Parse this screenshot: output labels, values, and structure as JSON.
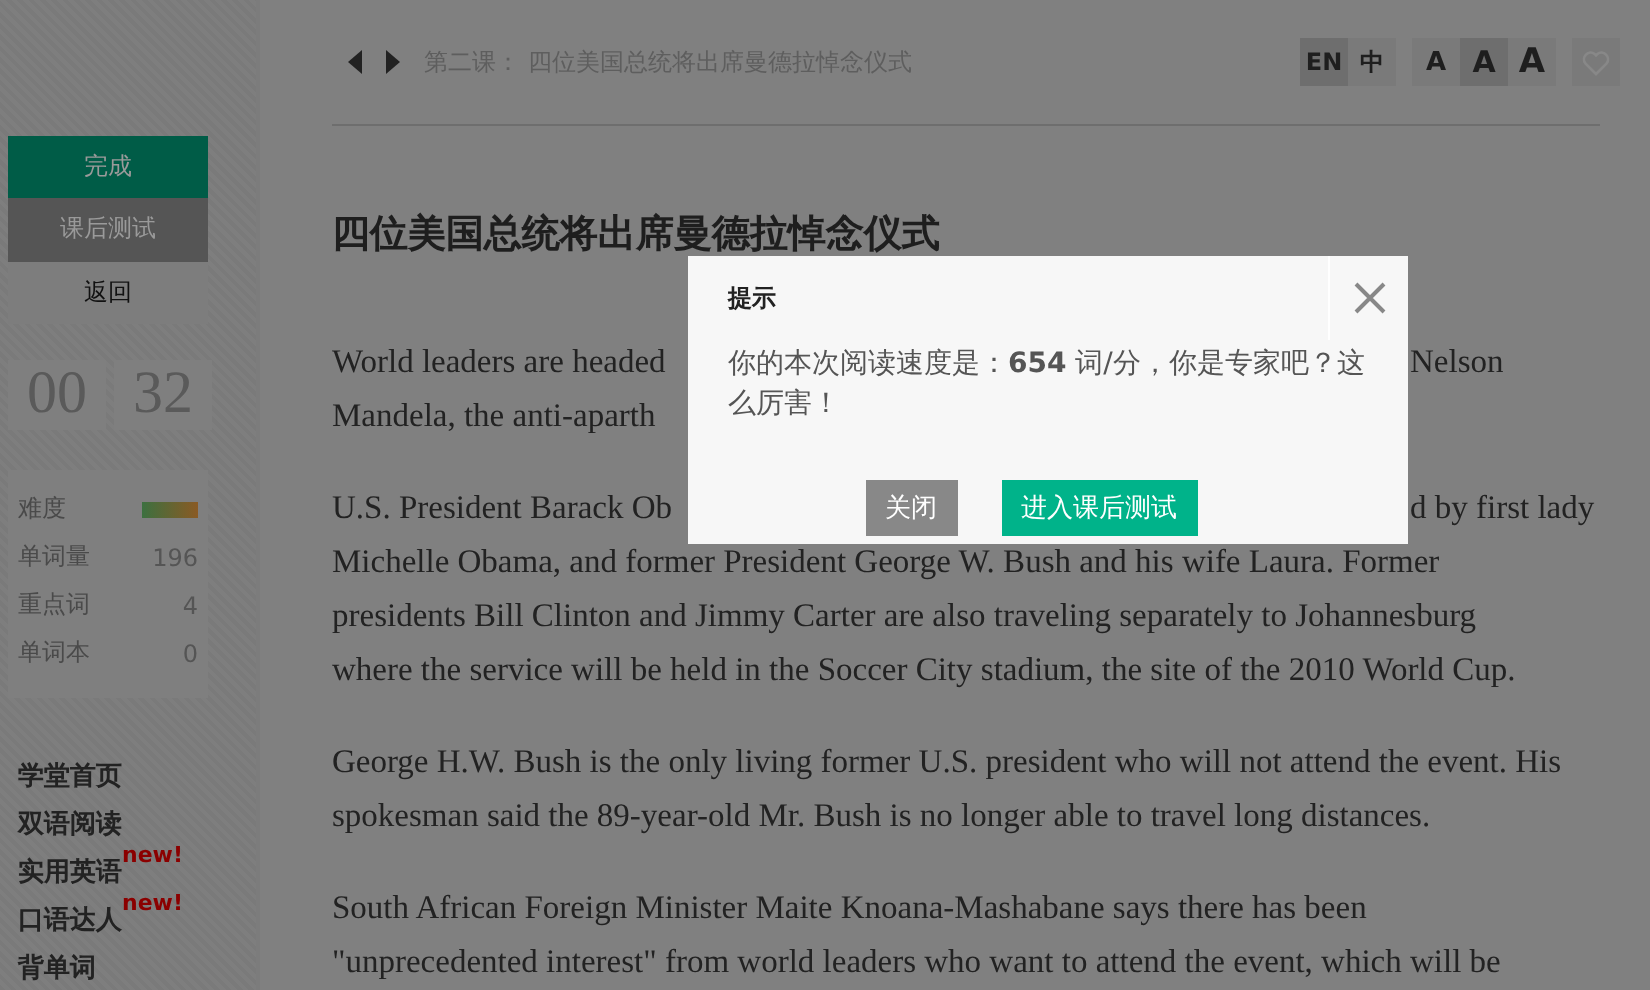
{
  "sidebar": {
    "actions": [
      {
        "label": "完成",
        "kind": "primary"
      },
      {
        "label": "课后测试",
        "kind": "secondary"
      },
      {
        "label": "返回",
        "kind": "plain"
      }
    ],
    "timer": [
      "00",
      "32"
    ],
    "stats": [
      {
        "label": "难度",
        "kind": "bar"
      },
      {
        "label": "单词量",
        "value": "196",
        "kind": "number"
      },
      {
        "label": "重点词",
        "value": "4",
        "kind": "number"
      },
      {
        "label": "单词本",
        "value": "0",
        "kind": "number"
      }
    ],
    "nav": [
      {
        "label": "学堂首页"
      },
      {
        "label": "双语阅读"
      },
      {
        "label": "实用英语",
        "badge": "new!"
      },
      {
        "label": "口语达人",
        "badge": "new!"
      },
      {
        "label": "背单词"
      }
    ]
  },
  "toolbar": {
    "lesson": "第二课：",
    "title": "四位美国总统将出席曼德拉悼念仪式",
    "languages": [
      {
        "label": "EN",
        "selected": true
      },
      {
        "label": "中",
        "selected": false
      }
    ],
    "font_sizes": [
      {
        "label": "A",
        "selected": false
      },
      {
        "label": "A",
        "selected": true
      },
      {
        "label": "A",
        "selected": false
      }
    ],
    "favorite": {
      "liked": false
    }
  },
  "article": {
    "title": "四位美国总统将出席曼德拉悼念仪式",
    "paragraphs": [
      [
        [
          "World leaders are headed",
          "Nelson"
        ],
        [
          "Mandela, the anti-aparth"
        ]
      ],
      [
        [
          "U.S. President Barack Ob",
          "d by first lady"
        ],
        [
          "Michelle Obama, and former President George W. Bush and his wife Laura. Former"
        ],
        [
          "presidents Bill Clinton and Jimmy Carter are also traveling separately to Johannesburg"
        ],
        [
          "where the service will be held in the Soccer City stadium, the site of the 2010 World Cup."
        ]
      ],
      [
        [
          "George H.W. Bush is the only living former U.S. president who will not attend the event. His"
        ],
        [
          "spokesman said the 89-year-old Mr. Bush is no longer able to travel long distances."
        ]
      ],
      [
        [
          "South African Foreign Minister Maite Knoana-Mashabane says there has been"
        ],
        [
          "\"unprecedented interest\" from world leaders who want to attend the event, which will be"
        ]
      ]
    ]
  },
  "dialog": {
    "title": "提示",
    "message": "你的本次阅读速度是：**654** 词/分，你是专家吧？这么厉害！",
    "buttons": [
      {
        "label": "关闭",
        "kind": "close"
      },
      {
        "label": "进入课后测试",
        "kind": "primary"
      }
    ]
  }
}
